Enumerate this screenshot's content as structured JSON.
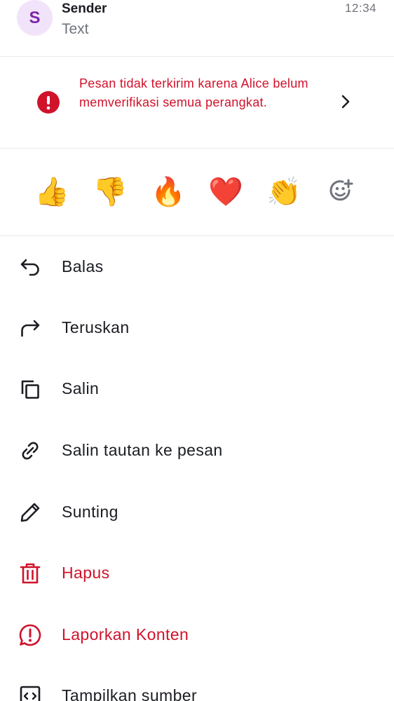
{
  "header": {
    "avatar_letter": "S",
    "sender": "Sender",
    "preview": "Text",
    "time": "12:34"
  },
  "warning": {
    "text": "Pesan tidak terkirim karena Alice belum memverifikasi semua perangkat.",
    "icon": "alert-circle-icon",
    "chevron": "chevron-right-icon"
  },
  "reactions": {
    "emojis": [
      "👍",
      "👎",
      "🔥",
      "❤️",
      "👏"
    ],
    "add_icon": "add-reaction-icon"
  },
  "menu": [
    {
      "label": "Balas",
      "icon": "reply-icon",
      "danger": false
    },
    {
      "label": "Teruskan",
      "icon": "forward-icon",
      "danger": false
    },
    {
      "label": "Salin",
      "icon": "copy-icon",
      "danger": false
    },
    {
      "label": "Salin tautan ke pesan",
      "icon": "link-icon",
      "danger": false
    },
    {
      "label": "Sunting",
      "icon": "pencil-icon",
      "danger": false
    },
    {
      "label": "Hapus",
      "icon": "trash-icon",
      "danger": true
    },
    {
      "label": "Laporkan Konten",
      "icon": "report-icon",
      "danger": true
    },
    {
      "label": "Tampilkan sumber",
      "icon": "code-icon",
      "danger": false
    }
  ],
  "colors": {
    "danger": "#d0122b",
    "avatar_bg": "#f1e4fa",
    "avatar_fg": "#7d25a8",
    "text_secondary": "#6f737b"
  }
}
